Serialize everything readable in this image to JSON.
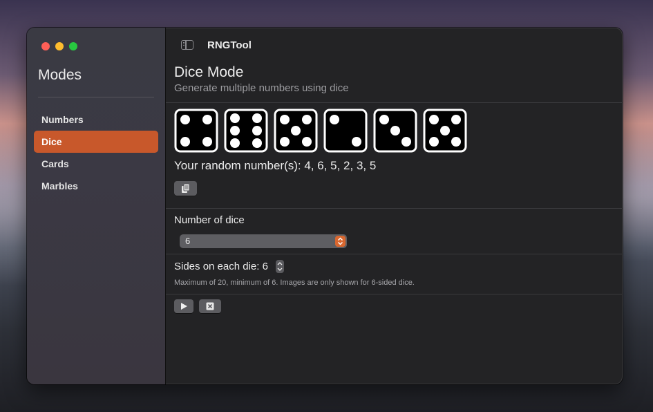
{
  "window": {
    "app_title": "RNGTool"
  },
  "sidebar": {
    "title": "Modes",
    "items": [
      {
        "label": "Numbers",
        "active": false
      },
      {
        "label": "Dice",
        "active": true
      },
      {
        "label": "Cards",
        "active": false
      },
      {
        "label": "Marbles",
        "active": false
      }
    ]
  },
  "main": {
    "title": "Dice Mode",
    "subtitle": "Generate multiple numbers using dice",
    "dice_values": [
      4,
      6,
      5,
      2,
      3,
      5
    ],
    "result_text": "Your random number(s): 4, 6, 5, 2, 3, 5",
    "number_of_dice_label": "Number of dice",
    "number_of_dice_value": "6",
    "sides_label": "Sides on each die: 6",
    "note": "Maximum of 20, minimum of 6. Images are only shown for 6-sided dice."
  },
  "icons": {
    "sidebar_toggle": "sidebar-toggle-icon",
    "copy": "copy-icon",
    "play": "play-icon",
    "clear": "clear-icon"
  },
  "colors": {
    "accent": "#c8582b",
    "close": "#ff5f57",
    "minimize": "#febc2e",
    "zoom": "#28c840"
  }
}
